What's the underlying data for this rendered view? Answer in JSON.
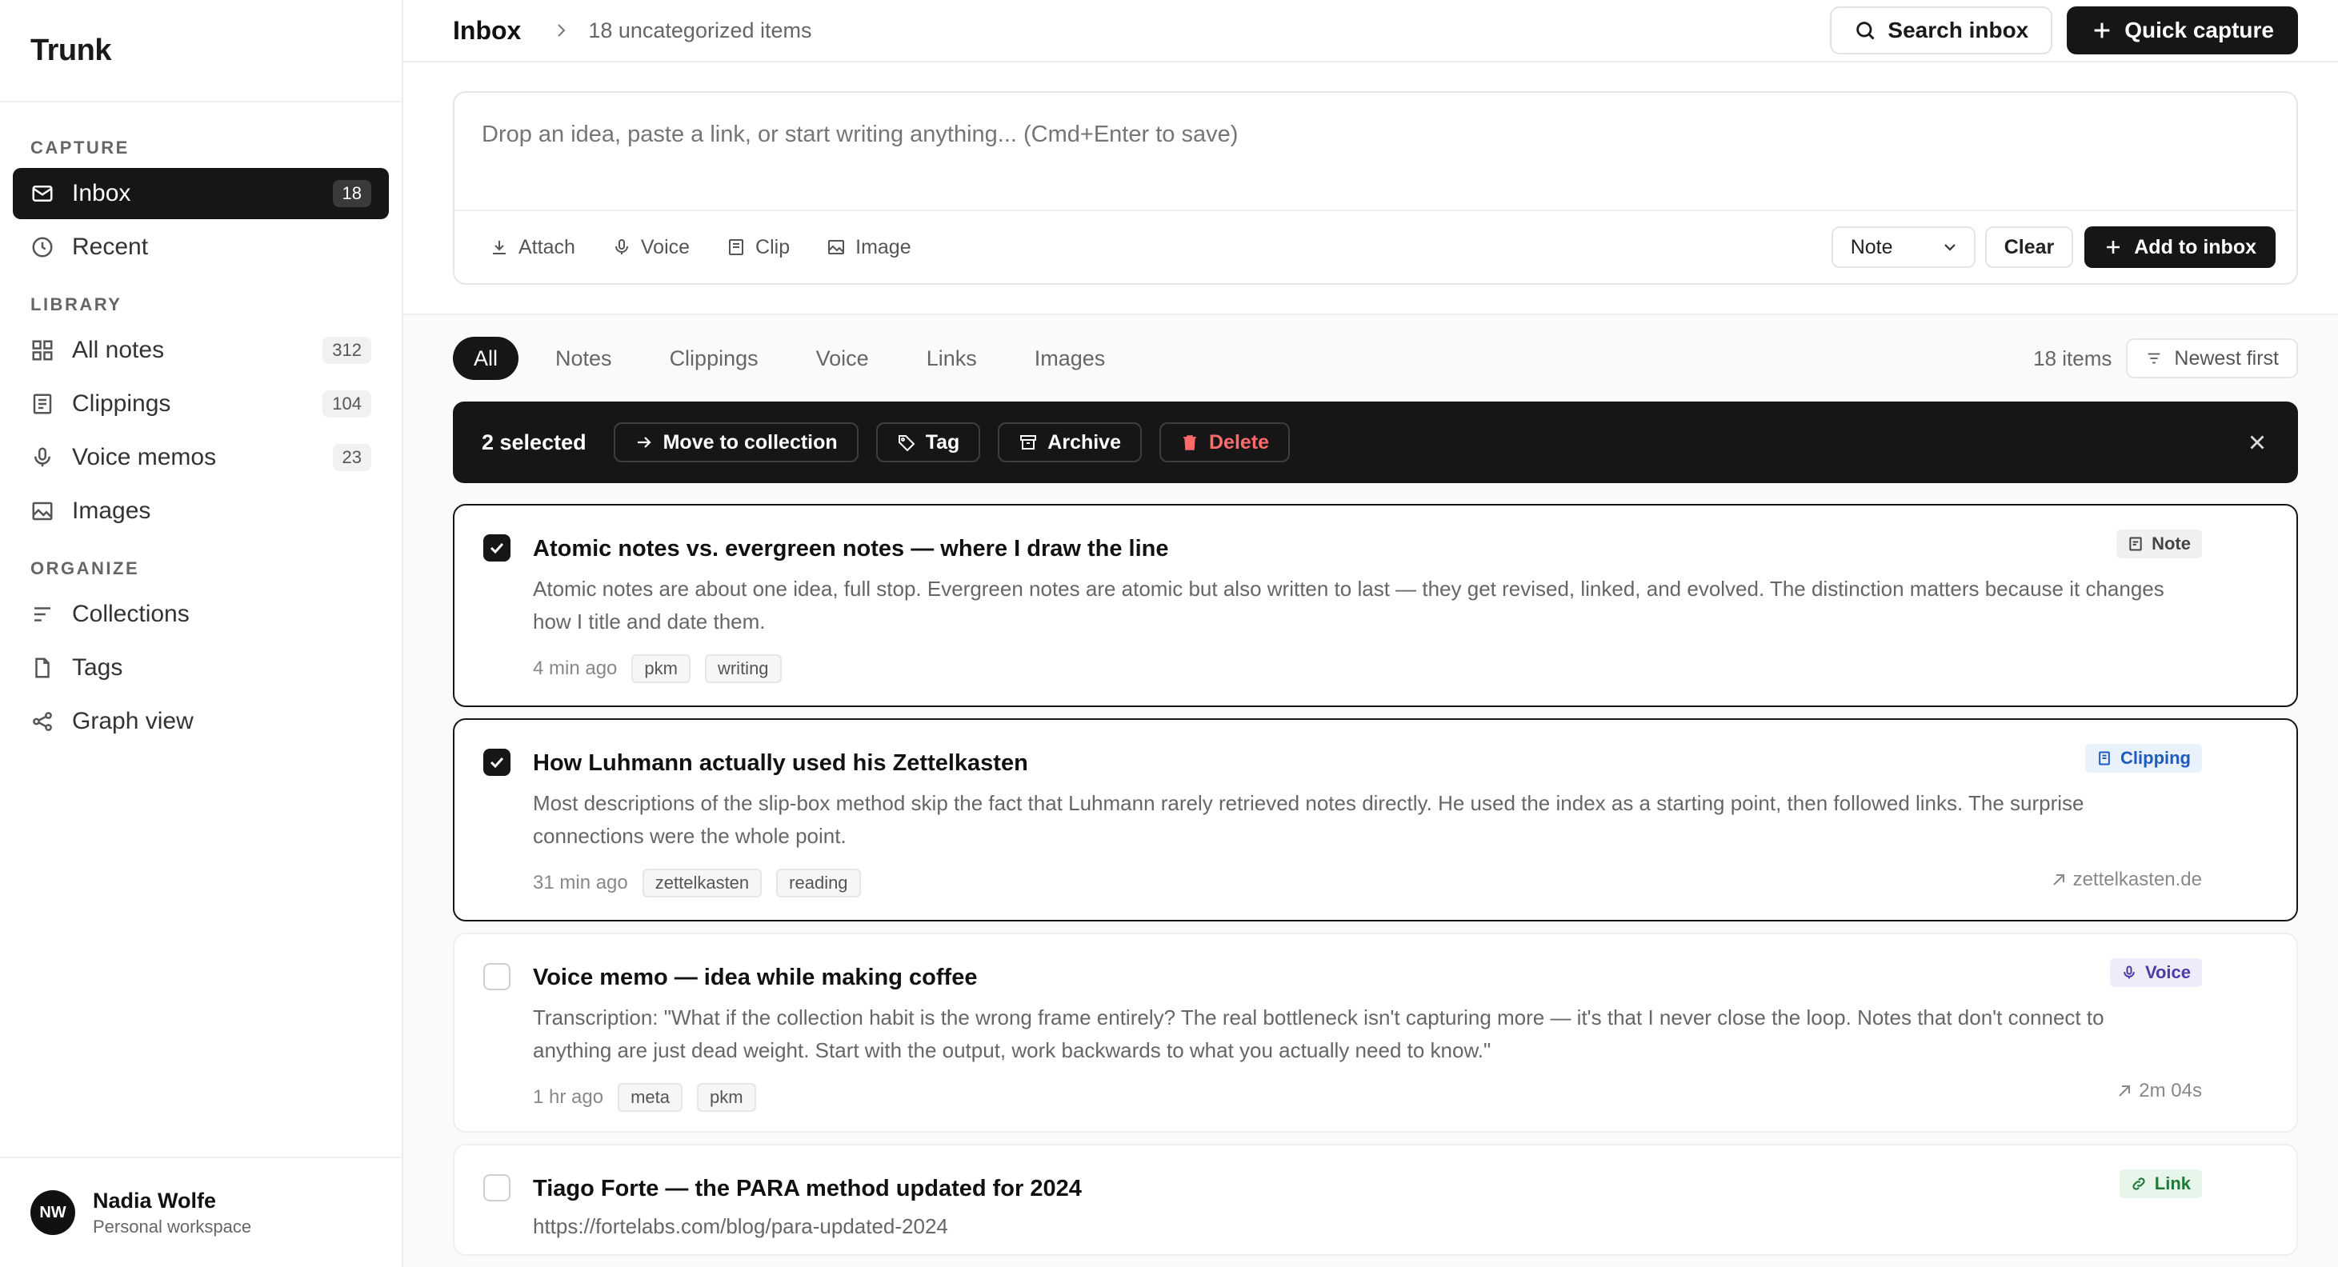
{
  "app": {
    "name": "Trunk"
  },
  "sidebar": {
    "sections": {
      "capture": "CAPTURE",
      "library": "LIBRARY",
      "organize": "ORGANIZE"
    },
    "items": [
      {
        "label": "Inbox",
        "count": "18",
        "icon": "inbox-icon"
      },
      {
        "label": "Recent",
        "icon": "clock-icon"
      },
      {
        "label": "All notes",
        "count": "312",
        "icon": "grid-icon"
      },
      {
        "label": "Clippings",
        "count": "104",
        "icon": "clipping-icon"
      },
      {
        "label": "Voice memos",
        "count": "23",
        "icon": "mic-icon"
      },
      {
        "label": "Images",
        "icon": "image-icon"
      },
      {
        "label": "Collections",
        "icon": "collections-icon"
      },
      {
        "label": "Tags",
        "icon": "file-icon"
      },
      {
        "label": "Graph view",
        "icon": "graph-icon"
      }
    ],
    "user": {
      "initials": "NW",
      "name": "Nadia Wolfe",
      "workspace": "Personal workspace"
    }
  },
  "header": {
    "title": "Inbox",
    "subtitle": "18 uncategorized items",
    "search_label": "Search inbox",
    "capture_label": "Quick capture"
  },
  "composer": {
    "placeholder": "Drop an idea, paste a link, or start writing anything... (Cmd+Enter to save)",
    "tools": [
      "Attach",
      "Voice",
      "Clip",
      "Image"
    ],
    "type_value": "Note",
    "clear_label": "Clear",
    "add_label": "Add to inbox"
  },
  "filters": {
    "chips": [
      "All",
      "Notes",
      "Clippings",
      "Voice",
      "Links",
      "Images"
    ],
    "active": "All",
    "items_count": "18 items",
    "sort_label": "Newest first"
  },
  "selection": {
    "count_label": "2 selected",
    "actions": [
      "Move to collection",
      "Tag",
      "Archive",
      "Delete"
    ]
  },
  "cards": [
    {
      "title": "Atomic notes vs. evergreen notes — where I draw the line",
      "body": "Atomic notes are about one idea, full stop. Evergreen notes are atomic but also written to last — they get revised, linked, and evolved. The distinction matters because it changes how I title and date them.",
      "time": "4 min ago",
      "tags": [
        "pkm",
        "writing"
      ],
      "type": "Note",
      "selected": true
    },
    {
      "title": "How Luhmann actually used his Zettelkasten",
      "body": "Most descriptions of the slip-box method skip the fact that Luhmann rarely retrieved notes directly. He used the index as a starting point, then followed links. The surprise connections were the whole point.",
      "time": "31 min ago",
      "tags": [
        "zettelkasten",
        "reading"
      ],
      "type": "Clipping",
      "meta_right": "zettelkasten.de",
      "selected": true
    },
    {
      "title": "Voice memo — idea while making coffee",
      "body": "Transcription: \"What if the collection habit is the wrong frame entirely? The real bottleneck isn't capturing more — it's that I never close the loop. Notes that don't connect to anything are just dead weight. Start with the output, work backwards to what you actually need to know.\"",
      "time": "1 hr ago",
      "tags": [
        "meta",
        "pkm"
      ],
      "type": "Voice",
      "meta_right": "2m 04s",
      "selected": false
    },
    {
      "title": "Tiago Forte — the PARA method updated for 2024",
      "url": "https://fortelabs.com/blog/para-updated-2024",
      "type": "Link",
      "selected": false
    }
  ]
}
